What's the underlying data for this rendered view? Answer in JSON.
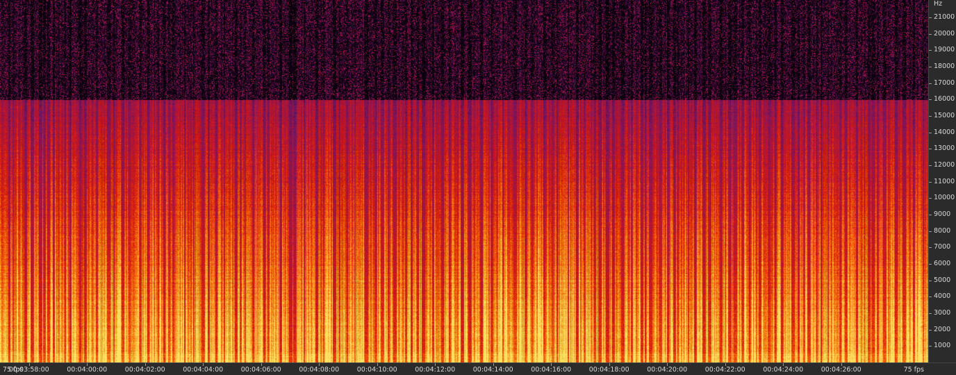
{
  "frequency_axis": {
    "unit_label": "Hz",
    "tick_labels": [
      "21000",
      "20000",
      "19000",
      "18000",
      "17000",
      "16000",
      "15000",
      "14000",
      "13000",
      "12000",
      "11000",
      "10000",
      "9000",
      "8000",
      "7000",
      "6000",
      "5000",
      "4000",
      "3000",
      "2000",
      "1000"
    ],
    "max_hz": 22050,
    "cutoff_hz": 16000
  },
  "time_axis": {
    "fps_left": "75 fps",
    "fps_right": "75 fps",
    "tick_labels": [
      "00:03:58:00",
      "00:04:00:00",
      "00:04:02:00",
      "00:04:04:00",
      "00:04:06:00",
      "00:04:08:00",
      "00:04:10:00",
      "00:04:12:00",
      "00:04:14:00",
      "00:04:16:00",
      "00:04:18:00",
      "00:04:20:00",
      "00:04:22:00",
      "00:04:24:00",
      "00:04:26:00"
    ],
    "start_seconds": 237.0,
    "end_seconds": 269.0
  },
  "colors": {
    "background": "#2b2b2b",
    "ruler_text": "#d8d8d8",
    "palette": [
      "#000000",
      "#3a0a4a",
      "#7a1466",
      "#b0123e",
      "#d61a10",
      "#f05a0a",
      "#f8a020",
      "#fde060"
    ]
  }
}
